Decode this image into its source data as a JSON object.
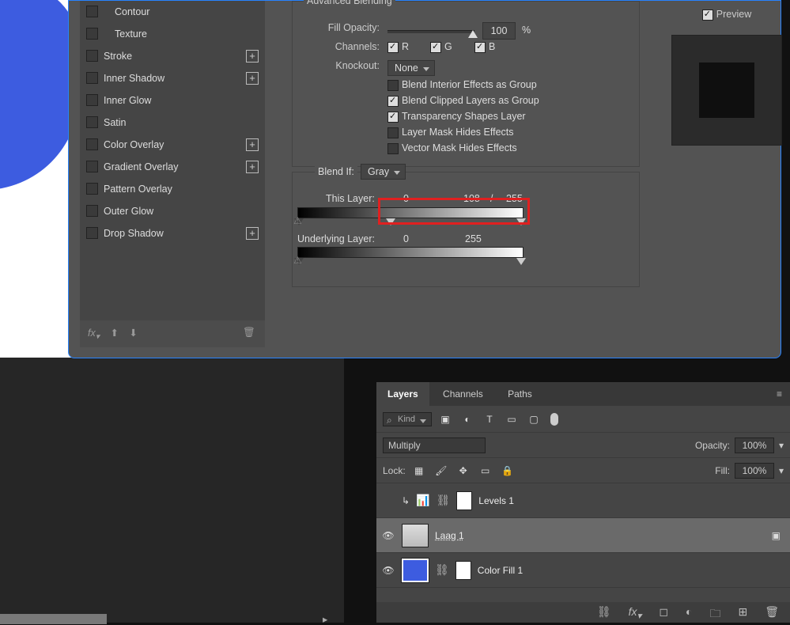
{
  "fx": {
    "items": [
      {
        "label": "Contour",
        "plus": false,
        "sub": true
      },
      {
        "label": "Texture",
        "plus": false,
        "sub": true
      },
      {
        "label": "Stroke",
        "plus": true
      },
      {
        "label": "Inner Shadow",
        "plus": true
      },
      {
        "label": "Inner Glow",
        "plus": false
      },
      {
        "label": "Satin",
        "plus": false
      },
      {
        "label": "Color Overlay",
        "plus": true
      },
      {
        "label": "Gradient Overlay",
        "plus": true
      },
      {
        "label": "Pattern Overlay",
        "plus": false
      },
      {
        "label": "Outer Glow",
        "plus": false
      },
      {
        "label": "Drop Shadow",
        "plus": true
      }
    ]
  },
  "adv": {
    "title": "Advanced Blending",
    "fill_opacity_label": "Fill Opacity:",
    "fill_opacity_value": "100",
    "fill_opacity_pct": "%",
    "channels_label": "Channels:",
    "ch_r": "R",
    "ch_g": "G",
    "ch_b": "B",
    "knockout_label": "Knockout:",
    "knockout_value": "None",
    "chk1": "Blend Interior Effects as Group",
    "chk2": "Blend Clipped Layers as Group",
    "chk3": "Transparency Shapes Layer",
    "chk4": "Layer Mask Hides Effects",
    "chk5": "Vector Mask Hides Effects"
  },
  "bif": {
    "label": "Blend If:",
    "channel": "Gray",
    "this_label": "This Layer:",
    "this_v0": "0",
    "this_v1": "108",
    "this_sep": "/",
    "this_v2": "255",
    "under_label": "Underlying Layer:",
    "under_v0": "0",
    "under_v1": "255"
  },
  "preview": {
    "label": "Preview"
  },
  "lp": {
    "tabs": {
      "layers": "Layers",
      "channels": "Channels",
      "paths": "Paths"
    },
    "kind": "Kind",
    "mode": "Multiply",
    "opacity_label": "Opacity:",
    "opacity": "100%",
    "lock_label": "Lock:",
    "fill_label": "Fill:",
    "fill": "100%",
    "layers": [
      {
        "name": "Levels 1"
      },
      {
        "name": "Laag 1"
      },
      {
        "name": "Color Fill 1"
      }
    ]
  }
}
